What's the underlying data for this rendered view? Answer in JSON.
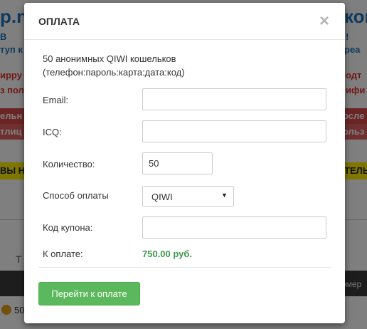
{
  "background": {
    "title_left": "p.ne",
    "title_right": "кош",
    "line2_left": "В",
    "line2_right": "!",
    "line3_left": "туп к",
    "line3_right": "реа",
    "red1_left": "ирру",
    "red1_right": "одт",
    "red2_left": "з пол",
    "red2_right": "ифи",
    "band_top_left": "ельн",
    "band_top_right": "осле",
    "band_bottom_left": "тлиц",
    "band_bottom_right": "ольз",
    "yellow_left": "ВЫ Н",
    "yellow_right": "ТЕЛЬ",
    "row_text_left": "Т",
    "dark_bar_right": "омер",
    "bottom_text": "50"
  },
  "modal": {
    "title": "ОПЛАТА",
    "close_glyph": "×",
    "product_line1": "50 анонимных QIWI кошельков",
    "product_line2": "(телефон:пароль:карта:дата:код)",
    "email_label": "Email:",
    "email_value": "",
    "icq_label": "ICQ:",
    "icq_value": "",
    "quantity_label": "Количество:",
    "quantity_value": "50",
    "payment_label": "Способ оплаты",
    "payment_selected": "QIWI",
    "coupon_label": "Код купона:",
    "coupon_value": "",
    "total_label": "К оплате:",
    "total_value": "750.00 руб.",
    "pay_button": "Перейти к оплате"
  },
  "colors": {
    "accent_green": "#5cb85c",
    "total_green": "#3b9b4b",
    "overlay": "rgba(0,0,0,0.5)"
  }
}
